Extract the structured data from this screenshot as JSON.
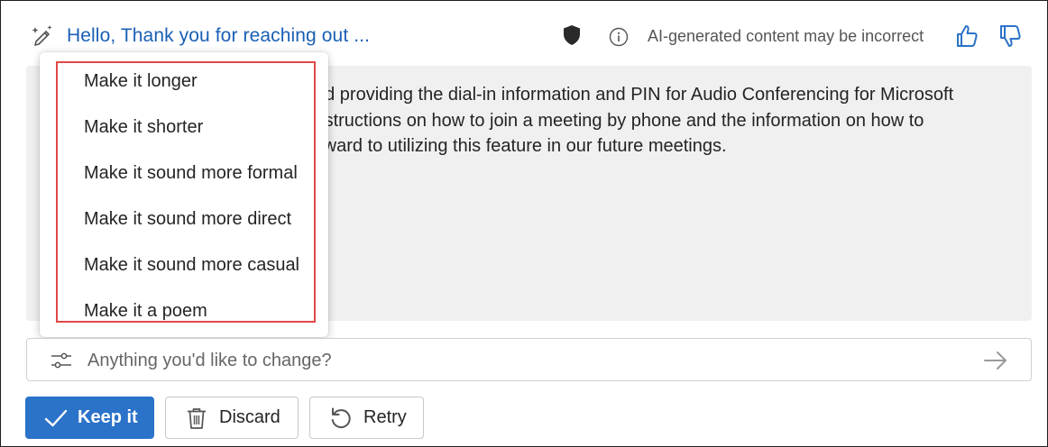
{
  "header": {
    "subject": "Hello, Thank you for reaching out ...",
    "disclaimer": "AI-generated content may be incorrect",
    "icons": [
      "pen-sparkle-icon",
      "shield-icon",
      "info-icon",
      "thumbs-up-icon",
      "thumbs-down-icon"
    ]
  },
  "content": {
    "lines": [
      "nd providing the dial-in information and PIN for Audio Conferencing for Microsoft",
      " instructions on how to join a meeting by phone and the information on how to",
      "rward to utilizing this feature in our future meetings."
    ]
  },
  "menu": {
    "items": [
      {
        "label": "Make it longer"
      },
      {
        "label": "Make it shorter"
      },
      {
        "label": "Make it sound more formal"
      },
      {
        "label": "Make it sound more direct"
      },
      {
        "label": "Make it sound more casual"
      },
      {
        "label": "Make it a poem"
      }
    ],
    "highlight_color": "#e04848"
  },
  "input": {
    "placeholder": "Anything you'd like to change?",
    "value": ""
  },
  "actions": {
    "keep_label": "Keep it",
    "discard_label": "Discard",
    "retry_label": "Retry"
  },
  "colors": {
    "accent": "#2b72c9",
    "subject": "#1a5fb4",
    "panel_bg": "#f0f0f0"
  }
}
